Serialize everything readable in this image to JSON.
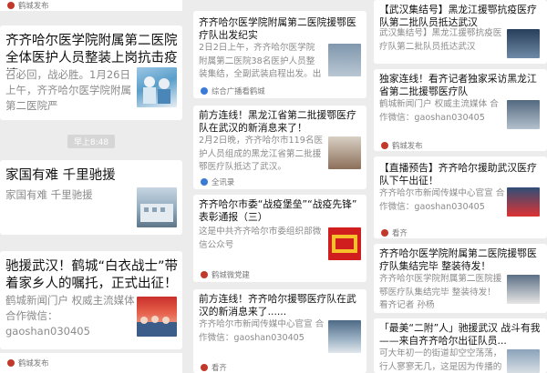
{
  "col1": {
    "top_source": "鹤城发布",
    "card1": {
      "title": "齐齐哈尔医学院附属第二医院全体医护人员整装上岗抗击疫情",
      "desc": "召必回，战必胜。1月26日上午，齐齐哈尔医学院附属第二医院严"
    },
    "time_tag": "早上8:48",
    "card2": {
      "title": "家国有难 千里驰援",
      "desc": "家国有难 千里驰援"
    },
    "card3": {
      "title": "驰援武汉！鹤城“白衣战士”带着家乡人的嘱托，正式出征！",
      "desc": "鹤城新闻门户 权威主流媒体 合作微信：gaoshan030405"
    },
    "bottom_source": "鹤城发布"
  },
  "col2": {
    "card1": {
      "title": "齐齐哈尔医学院附属第二医院援鄂医疗队出发纪实",
      "desc": "2日2日上午，齐齐哈尔医学院附属第二医院38名医护人员整装集结，全副武装启程出发。出发前，..."
    },
    "source1": "综合广播看鹤城",
    "card2": {
      "title": "前方连线！黑龙江省第二批援鄂医疗队在武汉的新消息来了！",
      "desc": "2月2日晚，齐齐哈尔市119名医护人员组成的黑龙江省第二批援鄂医疗队抵达了武汉。"
    },
    "source2": "全讯录",
    "card3": {
      "title": "齐齐哈尔市委“战疫堡垒”“战疫先锋” 表彰通报（三）",
      "desc": "这是中共齐齐哈尔市委组织部微信公众号"
    },
    "source3": "鹤城微党建",
    "card4": {
      "title": "前方连线！齐齐哈尔援鄂医疗队在武汉的新消息来了......",
      "desc": "齐齐哈尔市新闻传媒中心官宣 合作微信：gaoshan030405"
    },
    "source4": "看齐"
  },
  "col3": {
    "card1": {
      "title": "【武汉集结号】黑龙江援鄂抗疫医疗队第二批队员抵达武汉",
      "desc": "武汉集结号】黑龙江援鄂抗疫医疗队第二批队员抵达武汉"
    },
    "card2": {
      "title": "独家连线！看齐记者独家采访黑龙江省第二批援鄂医疗队",
      "desc": "鹤城新闻门户 权威主流媒体 合作微信：gaoshan030405"
    },
    "source2": "鹤城发布",
    "card3": {
      "title": "【直播预告】齐齐哈尔援助武汉医疗队下午出征！",
      "desc": "齐齐哈尔市新闻传媒中心官宣 合作微信：gaoshan030405"
    },
    "source3": "看齐",
    "card4": {
      "title": "齐齐哈尔医学院附属第二医院援鄂医疗队集结完毕 整装待发！",
      "desc": "齐齐哈尔医学院附属第二医院援鄂医疗队集结完毕 整装待发！ 看齐记者 孙杨"
    },
    "card5": {
      "title": "「最美“二附”人」驰援武汉 战斗有我——来自齐齐哈尔出征队员...",
      "desc": "可大年初一的街道却空空荡荡，行人寥寥无几，这是因为传播的面积生在着如何"
    }
  }
}
